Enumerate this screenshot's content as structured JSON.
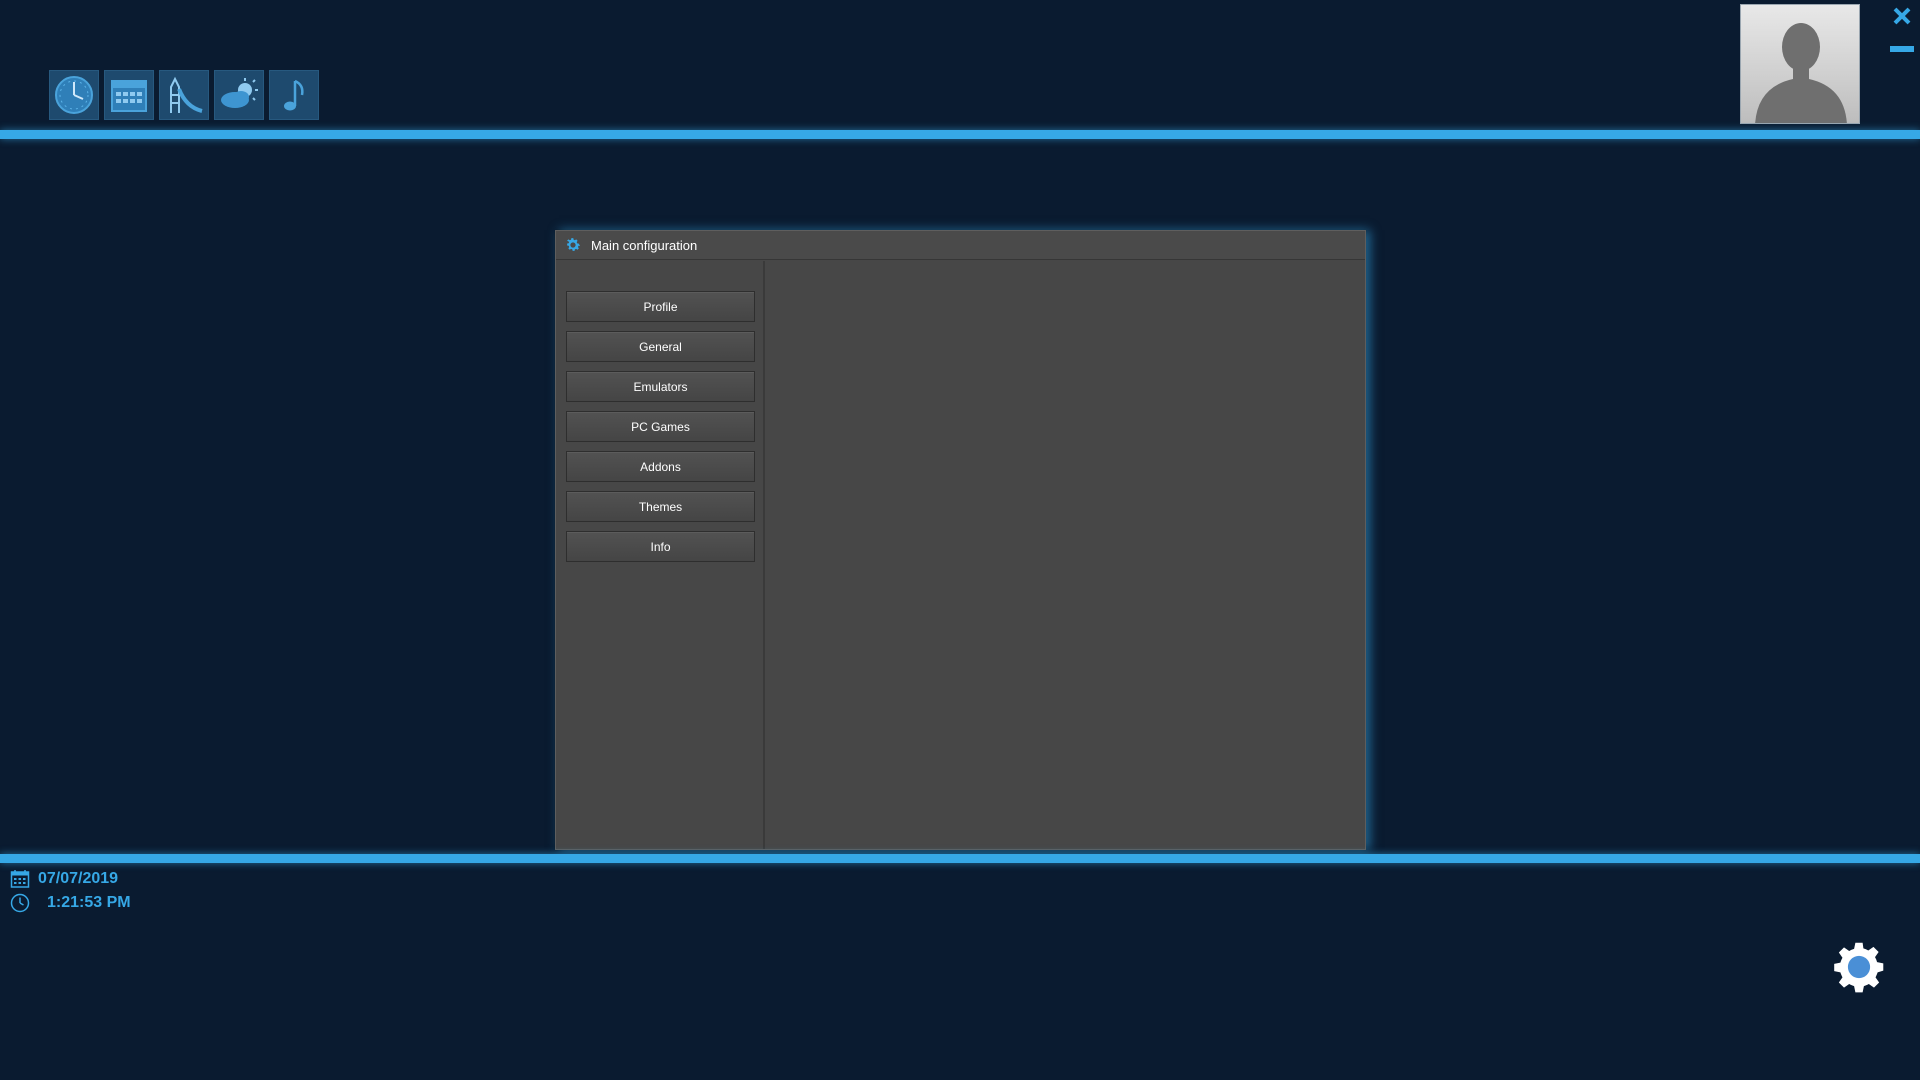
{
  "apps": [
    {
      "icon": "clock-app-icon"
    },
    {
      "icon": "calendar-app-icon"
    },
    {
      "icon": "playground-app-icon"
    },
    {
      "icon": "weather-app-icon"
    },
    {
      "icon": "music-app-icon"
    }
  ],
  "profile_blurred_label": "",
  "dialog": {
    "title": "Main configuration",
    "title_icon": "gear-icon",
    "nav": [
      {
        "label": "Profile"
      },
      {
        "label": "General"
      },
      {
        "label": "Emulators"
      },
      {
        "label": "PC Games"
      },
      {
        "label": "Addons"
      },
      {
        "label": "Themes"
      },
      {
        "label": "Info"
      }
    ]
  },
  "status": {
    "date": "07/07/2019",
    "time": "1:21:53 PM"
  },
  "colors": {
    "background": "#0a1b30",
    "accent": "#36a8e6",
    "dialog": "#474747"
  }
}
